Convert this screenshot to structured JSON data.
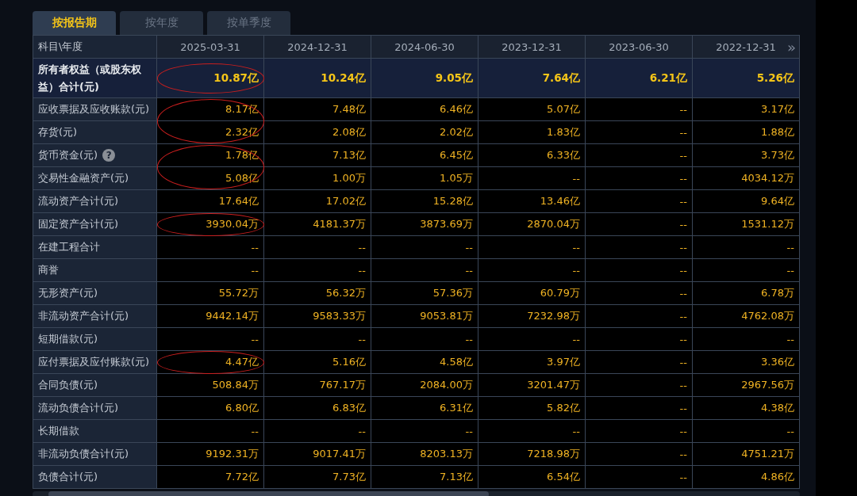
{
  "tabs": [
    {
      "label": "按报告期",
      "selected": true
    },
    {
      "label": "按年度",
      "selected": false
    },
    {
      "label": "按单季度",
      "selected": false
    }
  ],
  "table": {
    "corner": "科目\\年度",
    "columns": [
      "2025-03-31",
      "2024-12-31",
      "2024-06-30",
      "2023-12-31",
      "2023-06-30",
      "2022-12-31"
    ],
    "more": "»",
    "rows": [
      {
        "label": "所有者权益（或股东权益）合计(元)",
        "kind": "total",
        "circled": true,
        "values": [
          "10.87亿",
          "10.24亿",
          "9.05亿",
          "7.64亿",
          "6.21亿",
          "5.26亿"
        ]
      },
      {
        "label": "应收票据及应收账款(元)",
        "kind": "item",
        "circled": true,
        "circle_joins_next": true,
        "values": [
          "8.17亿",
          "7.48亿",
          "6.46亿",
          "5.07亿",
          "--",
          "3.17亿"
        ]
      },
      {
        "label": "存货(元)",
        "kind": "item",
        "circled": true,
        "values": [
          "2.32亿",
          "2.08亿",
          "2.02亿",
          "1.83亿",
          "--",
          "1.88亿"
        ]
      },
      {
        "label": "货币资金(元)",
        "kind": "item",
        "help": "?",
        "circled": true,
        "circle_joins_next": true,
        "values": [
          "1.78亿",
          "7.13亿",
          "6.45亿",
          "6.33亿",
          "--",
          "3.73亿"
        ]
      },
      {
        "label": "交易性金融资产(元)",
        "kind": "item",
        "circled": true,
        "values": [
          "5.08亿",
          "1.00万",
          "1.05万",
          "--",
          "--",
          "4034.12万"
        ]
      },
      {
        "label": "流动资产合计(元)",
        "kind": "item",
        "values": [
          "17.64亿",
          "17.02亿",
          "15.28亿",
          "13.46亿",
          "--",
          "9.64亿"
        ]
      },
      {
        "label": "固定资产合计(元)",
        "kind": "item",
        "circled": true,
        "values": [
          "3930.04万",
          "4181.37万",
          "3873.69万",
          "2870.04万",
          "--",
          "1531.12万"
        ]
      },
      {
        "label": "在建工程合计",
        "kind": "item",
        "values": [
          "--",
          "--",
          "--",
          "--",
          "--",
          "--"
        ]
      },
      {
        "label": "商誉",
        "kind": "item",
        "values": [
          "--",
          "--",
          "--",
          "--",
          "--",
          "--"
        ]
      },
      {
        "label": "无形资产(元)",
        "kind": "item",
        "values": [
          "55.72万",
          "56.32万",
          "57.36万",
          "60.79万",
          "--",
          "6.78万"
        ]
      },
      {
        "label": "非流动资产合计(元)",
        "kind": "item",
        "values": [
          "9442.14万",
          "9583.33万",
          "9053.81万",
          "7232.98万",
          "--",
          "4762.08万"
        ]
      },
      {
        "label": "短期借款(元)",
        "kind": "item",
        "values": [
          "--",
          "--",
          "--",
          "--",
          "--",
          "--"
        ]
      },
      {
        "label": "应付票据及应付账款(元)",
        "kind": "item",
        "circled": true,
        "values": [
          "4.47亿",
          "5.16亿",
          "4.58亿",
          "3.97亿",
          "--",
          "3.36亿"
        ]
      },
      {
        "label": "合同负债(元)",
        "kind": "item",
        "values": [
          "508.84万",
          "767.17万",
          "2084.00万",
          "3201.47万",
          "--",
          "2967.56万"
        ]
      },
      {
        "label": "流动负债合计(元)",
        "kind": "item",
        "values": [
          "6.80亿",
          "6.83亿",
          "6.31亿",
          "5.82亿",
          "--",
          "4.38亿"
        ]
      },
      {
        "label": "长期借款",
        "kind": "item",
        "values": [
          "--",
          "--",
          "--",
          "--",
          "--",
          "--"
        ]
      },
      {
        "label": "非流动负债合计(元)",
        "kind": "item",
        "values": [
          "9192.31万",
          "9017.41万",
          "8203.13万",
          "7218.98万",
          "--",
          "4751.21万"
        ]
      },
      {
        "label": "负债合计(元)",
        "kind": "item",
        "values": [
          "7.72亿",
          "7.73亿",
          "7.13亿",
          "6.54亿",
          "--",
          "4.86亿"
        ]
      }
    ]
  }
}
